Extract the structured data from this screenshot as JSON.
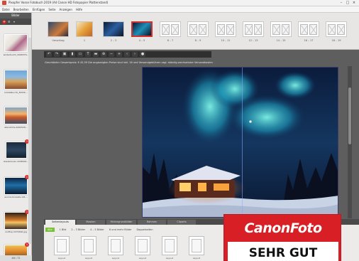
{
  "window": {
    "title": "Pixopfer Vosse Fotobuch 2019 (A4 Canon HD Fotopapier Plattenstand)",
    "controls": [
      "–",
      "□",
      "×"
    ]
  },
  "menu": [
    "Datei",
    "Bearbeiten",
    "Einfügen",
    "Seite",
    "Anzeigen",
    "Hilfe"
  ],
  "sidebar": {
    "header": "Bilder",
    "footer": "48 / 71",
    "items": [
      {
        "label": "winterbucht_2096376...",
        "badge": ""
      },
      {
        "label": "kristallbucht_3093b...",
        "badge": ""
      },
      {
        "label": "abendrote-4462526...",
        "badge": ""
      },
      {
        "label": "dreisterscan-4298091...",
        "badge": "1"
      },
      {
        "label": "aurora-borealis-141...",
        "badge": "1"
      },
      {
        "label": "rooftop-3274490.jpg",
        "badge": "1"
      },
      {
        "label": "sandsight4.jpg",
        "badge": "1"
      }
    ]
  },
  "pages": [
    {
      "label": "Umschlag",
      "kind": "photo"
    },
    {
      "label": "1",
      "kind": "photo"
    },
    {
      "label": "2 – 3",
      "kind": "photo"
    },
    {
      "label": "4 – 5",
      "kind": "photo",
      "selected": true
    },
    {
      "label": "6 – 7",
      "kind": "empty"
    },
    {
      "label": "8 – 9",
      "kind": "empty"
    },
    {
      "label": "10 – 11",
      "kind": "empty"
    },
    {
      "label": "12 – 13",
      "kind": "empty"
    },
    {
      "label": "14 – 15",
      "kind": "empty"
    },
    {
      "label": "16 – 17",
      "kind": "empty"
    },
    {
      "label": "18 – 19",
      "kind": "empty"
    }
  ],
  "toolbar": {
    "icons": [
      "undo-icon",
      "redo-icon",
      "save-icon",
      "page-icon",
      "image-icon",
      "text-icon",
      "sticker-icon",
      "clipart-icon",
      "zoom-out-icon",
      "zoom-in-icon",
      "prev-icon",
      "next-icon",
      "preview-icon"
    ],
    "glyphs": [
      "↶",
      "↷",
      "💾",
      "▮",
      "▭",
      "T",
      "▬",
      "⊕",
      "−",
      "+",
      "‹",
      "›",
      "●"
    ]
  },
  "status": "Geschätzter Gesamtpreis: € 45,59    Die angezeigten Preise sind inkl. 16 und Versandgebühren zzgl. ständig wechselnder Versandkosten",
  "bottom": {
    "tabs": [
      "Seitenlayouts",
      "Masken",
      "Hintergrundbilder",
      "Rahmen",
      "Cliparts"
    ],
    "filters": [
      "Alle",
      "1 Bild",
      "2 – 3 Bilder",
      "4 – 5 Bilder",
      "6 und mehr Bilder",
      "Doppelseiten"
    ],
    "layouts": [
      "Layout",
      "Layout",
      "Layout",
      "Layout",
      "Layout",
      "Layout"
    ]
  },
  "award": {
    "brand": "CanonFoto",
    "rating": "SEHR GUT"
  },
  "colors": {
    "accent": "#d32f2f",
    "filter_on": "#7bbf3a",
    "toolbar": "#2f2f2f"
  }
}
